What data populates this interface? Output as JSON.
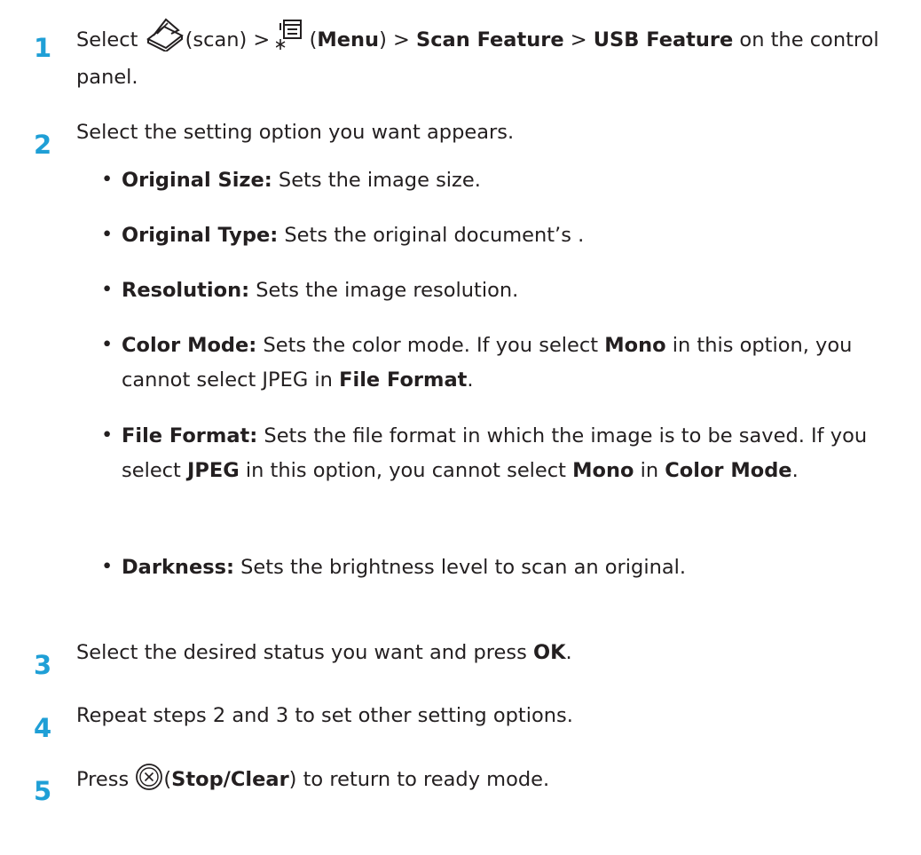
{
  "steps": [
    {
      "num": "1",
      "pre_select": "Select ",
      "scan_label": "(scan) > ",
      "menu_open": " (",
      "menu_label": "Menu",
      "menu_close": ") > ",
      "scan_feature": "Scan Feature",
      "sep": " > ",
      "usb_feature": "USB Feature",
      "tail": " on the control panel."
    },
    {
      "num": "2",
      "text": "Select the setting option you want appears."
    },
    {
      "num": "3",
      "pre": "Select the desired status you want and press ",
      "ok": "OK",
      "post": "."
    },
    {
      "num": "4",
      "text": "Repeat steps 2 and 3 to set other setting options."
    },
    {
      "num": "5",
      "pre": "Press ",
      "paren_open": "(",
      "stop_clear": "Stop/Clear",
      "post": ") to return to ready mode."
    }
  ],
  "bullet_char": "•",
  "options": [
    {
      "term": "Original Size:",
      "desc": " Sets the image size."
    },
    {
      "term": "Original Type:",
      "desc": " Sets the original document’s ."
    },
    {
      "term": "Resolution:",
      "desc": " Sets the image resolution."
    },
    {
      "term": "Color Mode:",
      "desc1": " Sets the color mode. If you select ",
      "b1": "Mono",
      "desc2": " in this option, you cannot select JPEG in ",
      "b2": "File Format",
      "desc3": "."
    },
    {
      "term": "File Format:",
      "desc1": " Sets the file format in which the image is to be saved. If you select ",
      "b1": "JPEG",
      "desc2": " in this option, you cannot select ",
      "b2": "Mono",
      "desc3": " in ",
      "b3": "Color Mode",
      "desc4": "."
    },
    {
      "term": "Darkness:",
      "desc": " Sets the brightness level to scan an original."
    }
  ],
  "icons": {
    "scan": "scan-icon",
    "menu": "menu-icon",
    "stop": "stop-clear-icon"
  },
  "colors": {
    "step_number": "#1f9fd6",
    "text": "#231f20"
  }
}
